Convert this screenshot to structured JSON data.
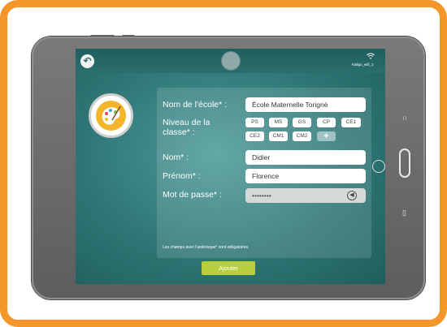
{
  "status_bar": {
    "wifi_label": "Kaligo_wifi_1"
  },
  "form": {
    "school_label": "Nom de l'école* :",
    "school_value": "École Maternelle Torigné",
    "level_label": "Niveau de la classe* :",
    "levels": [
      "PS",
      "MS",
      "GS",
      "CP",
      "CE1",
      "CE2",
      "CM1",
      "CM2"
    ],
    "add_level": "+",
    "lastname_label": "Nom* :",
    "lastname_value": "Didier",
    "firstname_label": "Prénom* :",
    "firstname_value": "Florence",
    "password_label": "Mot de passe* :",
    "password_value": "••••••••",
    "required_note": "Les champs avec l'astérisque* sont obligatoires.",
    "submit_label": "Ajouter"
  },
  "colors": {
    "frame": "#f5962a",
    "screen": "#2e7675",
    "submit": "#b9cf3a",
    "palette": "#f3b52b"
  }
}
